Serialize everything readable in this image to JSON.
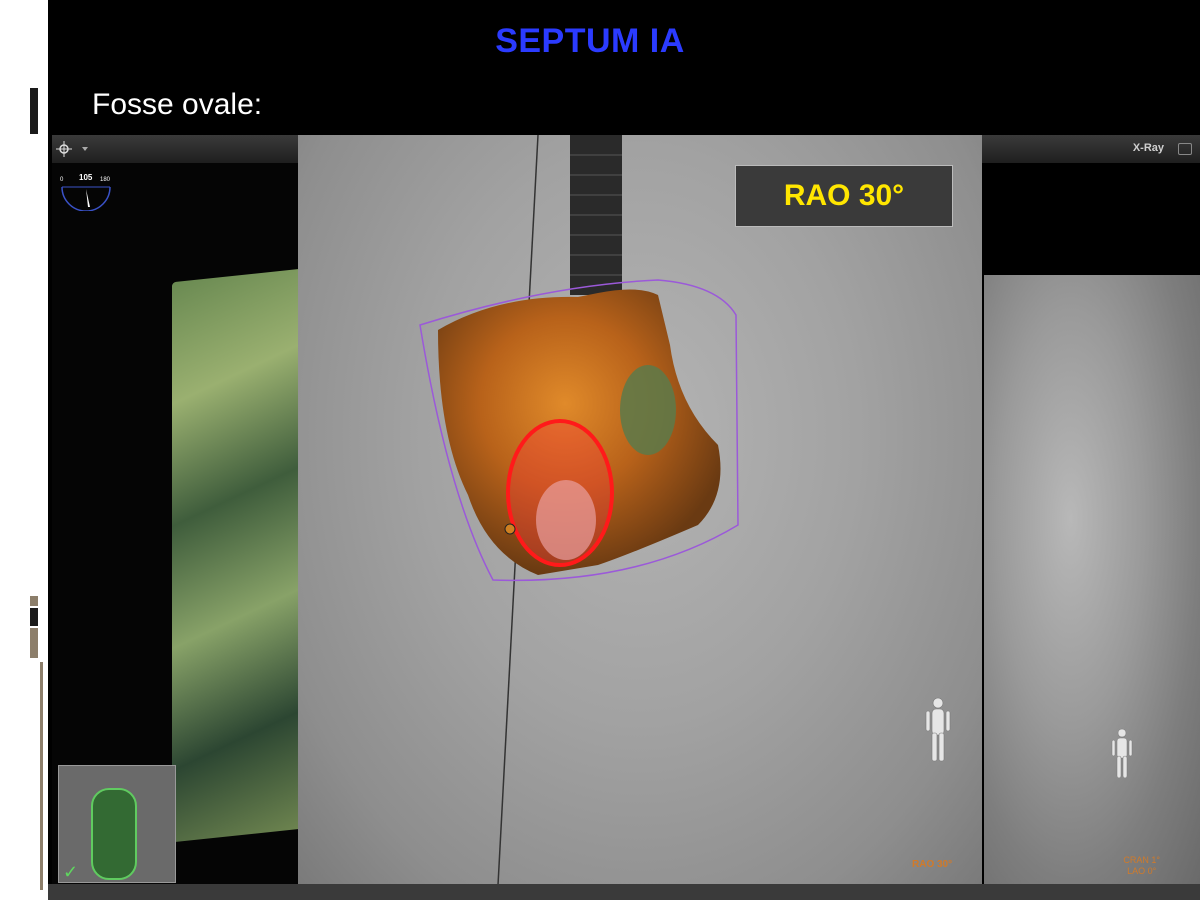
{
  "slide": {
    "title": "SEPTUM IA",
    "subtitle": "Fosse ovale:"
  },
  "left_panel": {
    "gauge": {
      "min_label": "0",
      "value_label": "105",
      "max_label": "180"
    },
    "thumbnail_status_icon": "checkmark-icon"
  },
  "main_view": {
    "projection_label": "RAO 30°",
    "corner_caption": "RAO  30°",
    "overlay_marker_color": "#ff1a1a",
    "overlay_3d_colors": [
      "#c8741e",
      "#8a4a14",
      "#5c7a4a"
    ],
    "outline_color": "#9b59d9"
  },
  "right_panel": {
    "mode_label": "X-Ray",
    "caption_line1": "CRAN  1°",
    "caption_line2": "LAO  0°"
  },
  "colors": {
    "title": "#2b3bff",
    "projection_label": "#ffe600",
    "background": "#000000"
  }
}
